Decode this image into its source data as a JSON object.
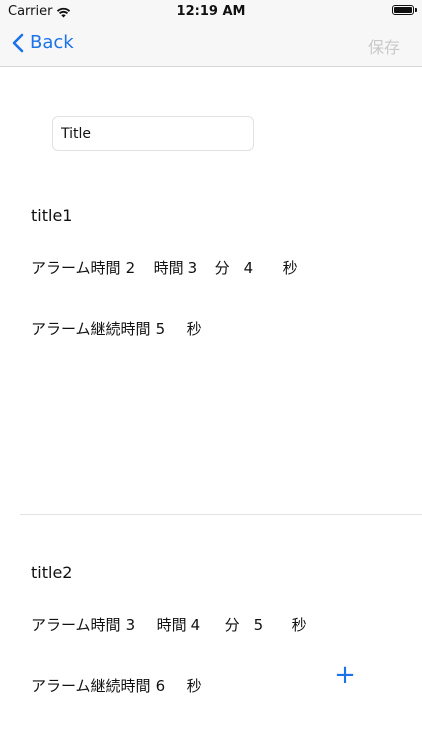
{
  "status_bar": {
    "carrier": "Carrier",
    "time": "12:19 AM"
  },
  "nav": {
    "back_label": "Back",
    "save_label": "保存"
  },
  "title_input": {
    "value": "Title"
  },
  "sections": [
    {
      "title": "title1",
      "alarm_time_label": "アラーム時間",
      "hours_value": "2",
      "hours_unit": "時間",
      "minutes_value": "3",
      "minutes_unit": "分",
      "seconds_value": "4",
      "seconds_unit": "秒",
      "duration_label": "アラーム継続時間",
      "duration_value": "5",
      "duration_unit": "秒"
    },
    {
      "title": "title2",
      "alarm_time_label": "アラーム時間",
      "hours_value": "3",
      "hours_unit": "時間",
      "minutes_value": "4",
      "minutes_unit": "分",
      "seconds_value": "5",
      "seconds_unit": "秒",
      "duration_label": "アラーム継続時間",
      "duration_value": "6",
      "duration_unit": "秒"
    }
  ],
  "add_button": {
    "icon": "+"
  },
  "colors": {
    "accent": "#1a73e8",
    "disabled": "#c9c9c9"
  }
}
